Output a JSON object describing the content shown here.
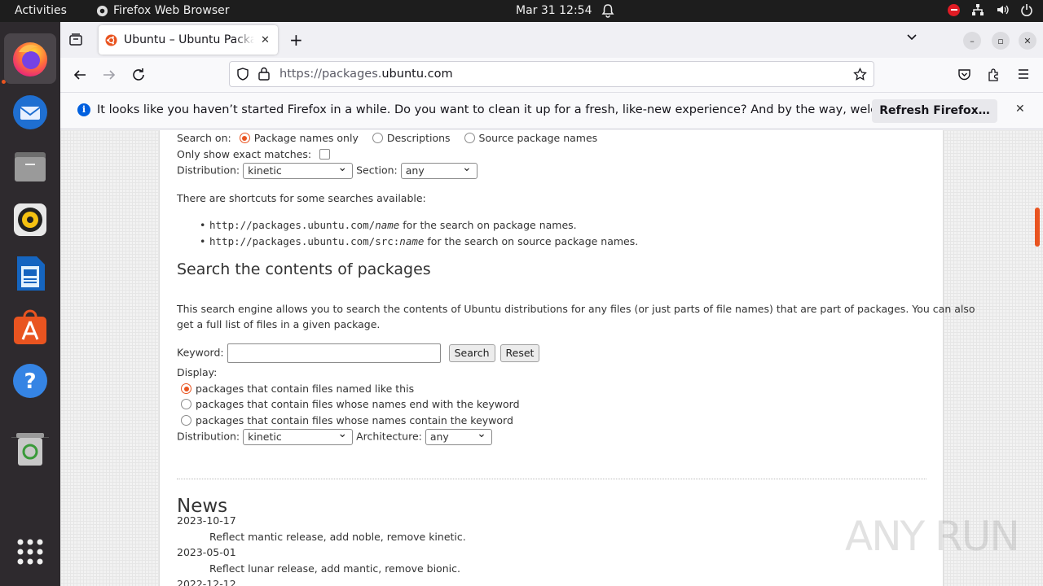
{
  "topbar": {
    "activities": "Activities",
    "app_name": "Firefox Web Browser",
    "clock": "Mar 31  12:54"
  },
  "tab": {
    "title": "Ubuntu – Ubuntu Packages Search"
  },
  "navbar": {
    "url_prefix": "https://packages.",
    "url_domain": "ubuntu.com"
  },
  "notification": {
    "message": "It looks like you haven’t started Firefox in a while. Do you want to clean it up for a fresh, like-new experience? And by the way, welcome back!",
    "button": "Refresh Firefox…"
  },
  "search_form": {
    "search_on_label": "Search on:",
    "options": [
      "Package names only",
      "Descriptions",
      "Source package names"
    ],
    "exact_label": "Only show exact matches:",
    "distribution_label": "Distribution:",
    "distribution_value": "kinetic",
    "section_label": "Section:",
    "section_value": "any",
    "shortcuts_intro": "There are shortcuts for some searches available:",
    "shortcut1_url": "http://packages.ubuntu.com/",
    "shortcut1_var": "name",
    "shortcut1_text": " for the search on package names.",
    "shortcut2_url": "http://packages.ubuntu.com/src:",
    "shortcut2_var": "name",
    "shortcut2_text": " for the search on source package names."
  },
  "contents_search": {
    "heading": "Search the contents of packages",
    "description_line1": "This search engine allows you to search the contents of Ubuntu distributions for any files (or just parts of file names) that are part of packages. You can also",
    "description_line2": "get a full list of files in a given package.",
    "keyword_label": "Keyword:",
    "keyword_value": "",
    "search_button": "Search",
    "reset_button": "Reset",
    "display_label": "Display:",
    "display_options": [
      "packages that contain files named like this",
      "packages that contain files whose names end with the keyword",
      "packages that contain files whose names contain the keyword"
    ],
    "distribution_label": "Distribution:",
    "distribution_value": "kinetic",
    "architecture_label": "Architecture:",
    "architecture_value": "any"
  },
  "news": {
    "heading": "News",
    "items": [
      {
        "date": "2023-10-17",
        "text": "Reflect mantic release, add noble, remove kinetic."
      },
      {
        "date": "2023-05-01",
        "text": "Reflect lunar release, add mantic, remove bionic."
      },
      {
        "date": "2022-12-12",
        "text": ""
      }
    ]
  },
  "watermark": "ANY RUN",
  "colors": {
    "accent": "#e95420",
    "firefox_blue": "#0060df"
  }
}
